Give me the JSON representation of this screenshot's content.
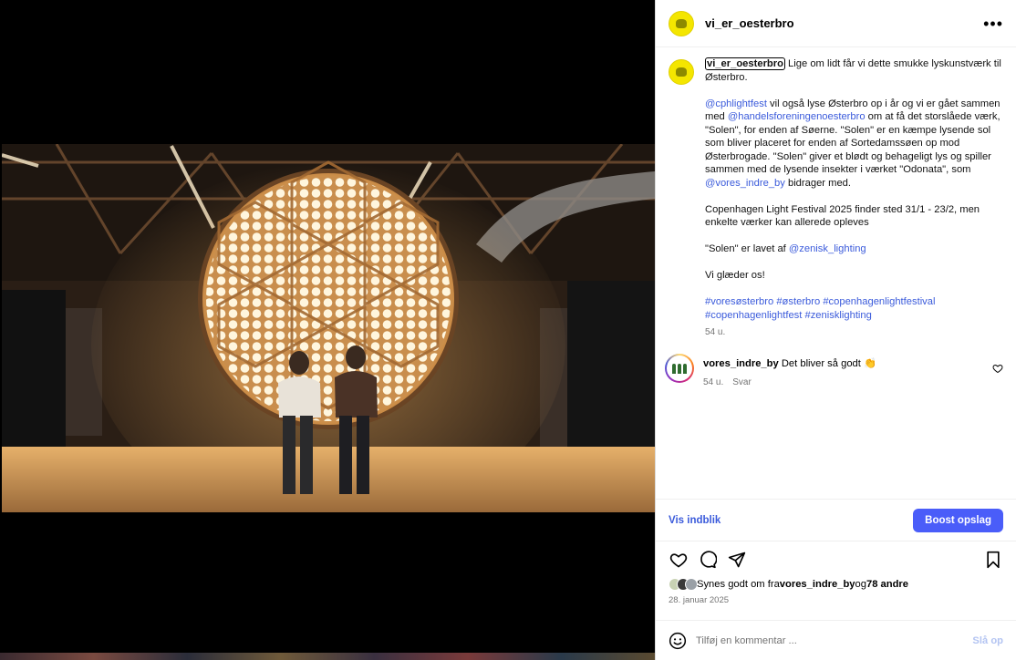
{
  "post": {
    "username": "vi_er_oesterbro",
    "more_icon": "more-horizontal-icon"
  },
  "caption": {
    "author": "vi_er_oesterbro",
    "line1": " Lige om lidt får vi dette smukke lyskunstværk til Østerbro.",
    "p2_mention1": "@cphlightfest",
    "p2_text1": " vil også lyse Østerbro op i år og vi er gået sammen med ",
    "p2_mention2": "@handelsforeningenoesterbro",
    "p2_text2": " om at få det storslåede værk, \"Solen\", for enden af Søerne. \"Solen\" er en kæmpe lysende sol som bliver placeret for enden af Sortedamssøen op mod Østerbrogade. \"Solen\" giver et blødt og behageligt lys og spiller sammen med de lysende insekter i værket \"Odonata\", som ",
    "p2_mention3": "@vores_indre_by",
    "p2_text3": " bidrager med.",
    "p3": "Copenhagen Light Festival 2025 finder sted 31/1 - 23/2, men enkelte værker kan allerede opleves",
    "p4_text": "\"Solen\" er lavet af ",
    "p4_mention": "@zenisk_lighting",
    "p5": "Vi glæder os!",
    "hashtags": "#voresøsterbro #østerbro #copenhagenlightfestival #copenhagenlightfest #zenisklighting",
    "time": "54 u."
  },
  "comment": {
    "username": "vores_indre_by",
    "text": " Det bliver så godt 👏",
    "time": "54 u.",
    "reply": "Svar"
  },
  "insight": {
    "label": "Vis indblik",
    "boost_label": "Boost opslag"
  },
  "likes": {
    "prefix": "Synes godt om fra ",
    "user": "vores_indre_by",
    "middle": " og ",
    "others": "78 andre",
    "date": "28. januar 2025"
  },
  "add_comment": {
    "placeholder": "Tilføj en kommentar ...",
    "post_label": "Slå op"
  },
  "colors": {
    "accent": "#4a5df9",
    "link": "#3b5bdb"
  }
}
